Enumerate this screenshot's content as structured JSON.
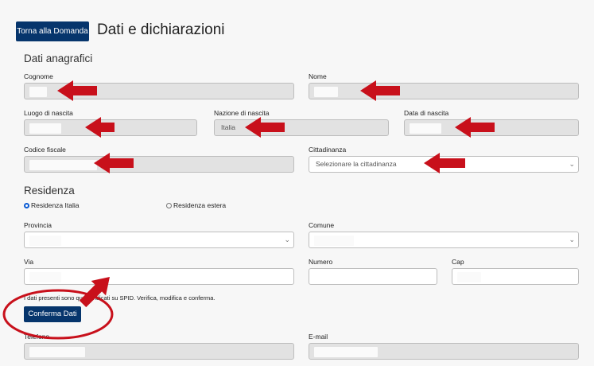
{
  "header": {
    "back_label": "Torna alla Domanda",
    "title": "Dati e dichiarazioni"
  },
  "anagrafici": {
    "section_title": "Dati anagrafici",
    "cognome_label": "Cognome",
    "nome_label": "Nome",
    "luogo_label": "Luogo di nascita",
    "nazione_label": "Nazione di nascita",
    "nazione_value": "Italia",
    "data_label": "Data di nascita",
    "cf_label": "Codice fiscale",
    "cittadinanza_label": "Cittadinanza",
    "cittadinanza_placeholder": "Selezionare la cittadinanza"
  },
  "residenza": {
    "section_title": "Residenza",
    "radio_italia": "Residenza Italia",
    "radio_estera": "Residenza estera",
    "provincia_label": "Provincia",
    "comune_label": "Comune",
    "via_label": "Via",
    "numero_label": "Numero",
    "cap_label": "Cap"
  },
  "footer": {
    "note": "I dati presenti sono quelli indicati su SPID. Verifica, modifica e conferma.",
    "confirm_label": "Conferma Dati",
    "telefono_label": "Telefono",
    "email_label": "E-mail"
  },
  "colors": {
    "primary": "#06356c",
    "annotation": "#c8101b"
  }
}
